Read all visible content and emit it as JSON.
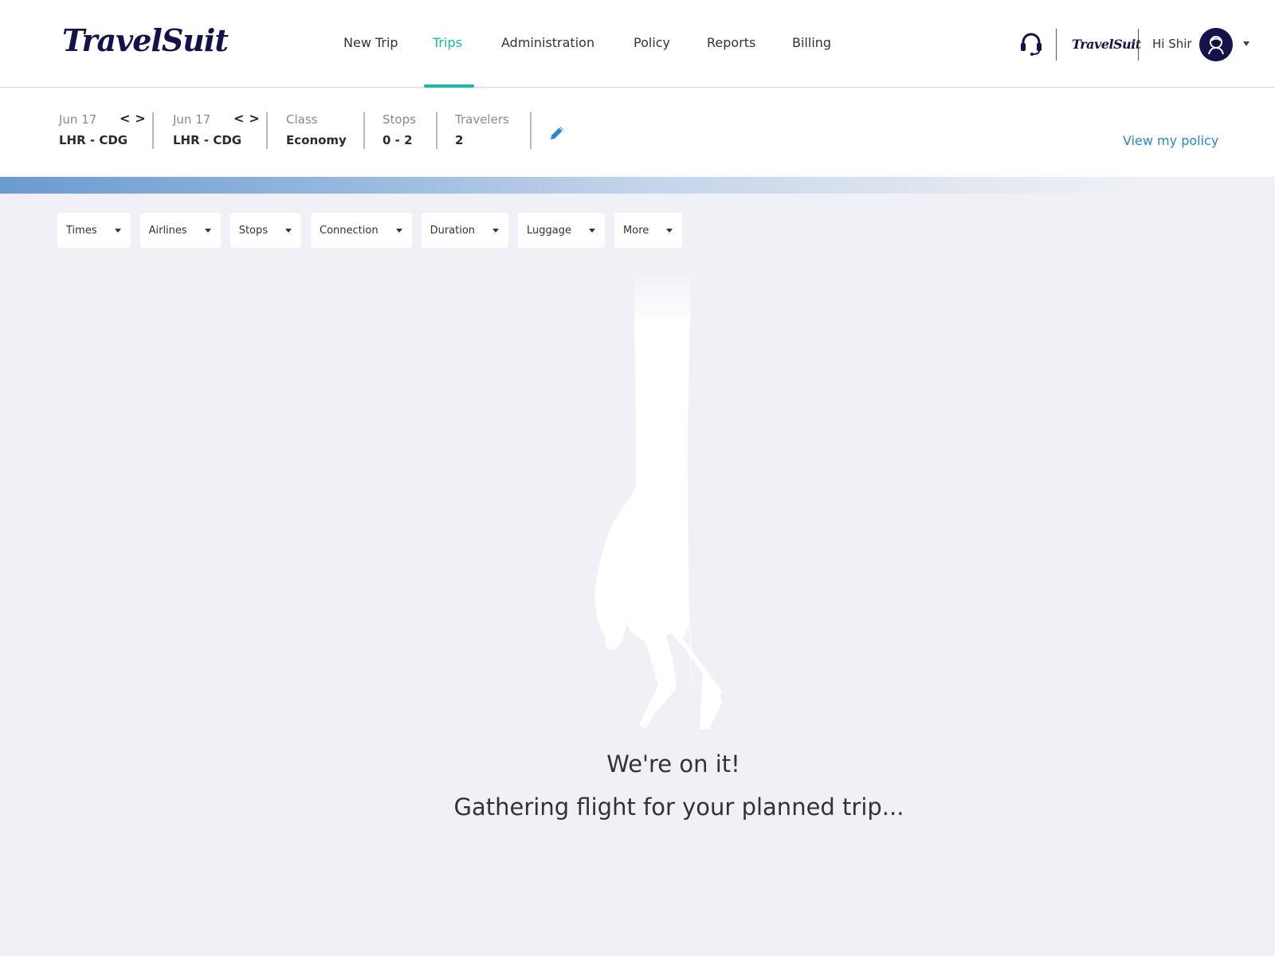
{
  "header": {
    "logo_text": "TravelSuit",
    "nav": [
      {
        "label": "New Trip",
        "active": false
      },
      {
        "label": "Trips",
        "active": true
      },
      {
        "label": "Administration",
        "active": false
      },
      {
        "label": "Policy",
        "active": false
      },
      {
        "label": "Reports",
        "active": false
      },
      {
        "label": "Billing",
        "active": false
      }
    ],
    "support_icon": "headset-icon",
    "company_logo_text": "TravelSuit",
    "greeting": "Hi Shir",
    "avatar_icon": "user-avatar-icon",
    "accent_color": "#1cb8a8",
    "brand_color": "#14124a"
  },
  "summary": {
    "legs": [
      {
        "date": "Jun 17",
        "route": "LHR - CDG"
      },
      {
        "date": "Jun 17",
        "route": "LHR - CDG"
      }
    ],
    "class": {
      "label": "Class",
      "value": "Economy"
    },
    "stops": {
      "label": "Stops",
      "value": "0 - 2"
    },
    "travelers": {
      "label": "Travelers",
      "value": "2"
    },
    "prev_glyph": "<",
    "next_glyph": ">",
    "edit_icon": "pencil-icon",
    "policy_link": "View my policy",
    "link_color": "#2b86cf"
  },
  "filters": [
    {
      "label": "Times"
    },
    {
      "label": "Airlines"
    },
    {
      "label": "Stops"
    },
    {
      "label": "Connection"
    },
    {
      "label": "Duration"
    },
    {
      "label": "Luggage"
    },
    {
      "label": "More"
    }
  ],
  "loading": {
    "title": "We're on it!",
    "subtitle": "Gathering flight for your planned trip..."
  }
}
